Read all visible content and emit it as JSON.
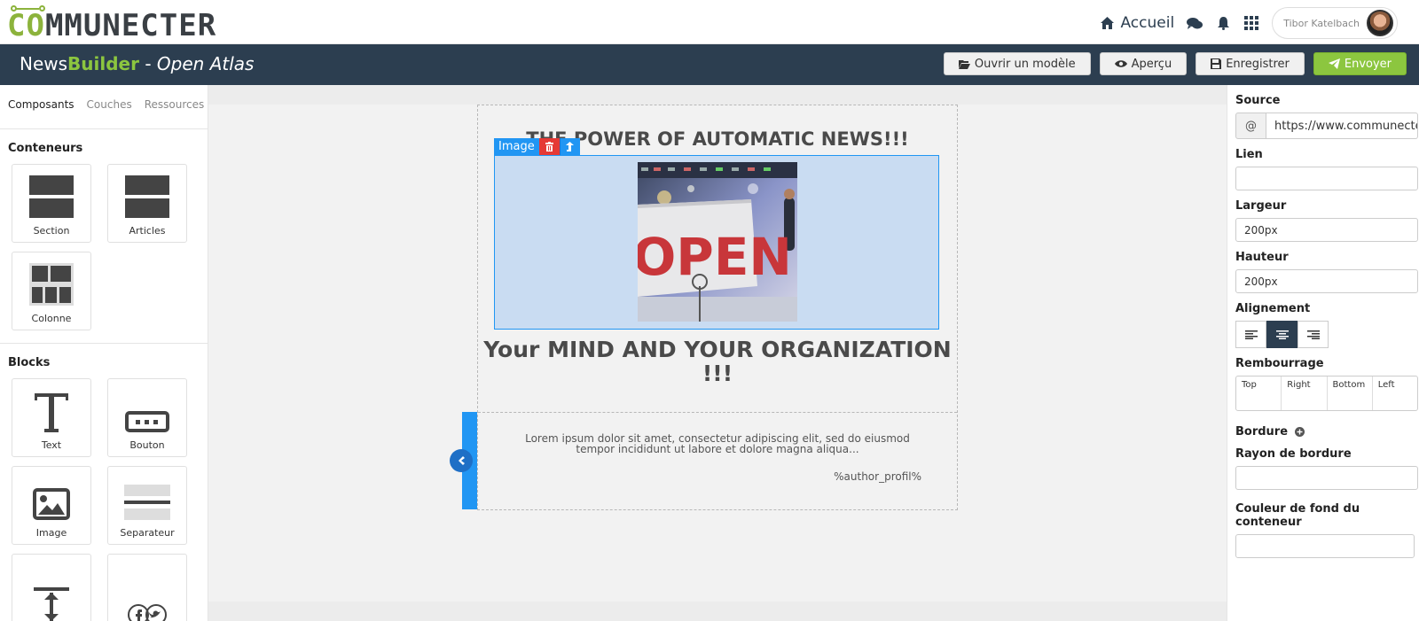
{
  "topbar": {
    "logo_co": "CO",
    "logo_rest": "MMUNECTER",
    "home_label": "Accueil",
    "user_name": "Tibor Katelbach"
  },
  "builder": {
    "title_news": "News",
    "title_builder": "Builder",
    "title_sep": " - ",
    "project": "Open Atlas",
    "buttons": {
      "open_model": "Ouvrir un modèle",
      "preview": "Aperçu",
      "save": "Enregistrer",
      "send": "Envoyer"
    }
  },
  "left": {
    "tabs": [
      "Composants",
      "Couches",
      "Ressources"
    ],
    "containers_title": "Conteneurs",
    "containers": [
      "Section",
      "Articles",
      "Colonne"
    ],
    "blocks_title": "Blocks",
    "blocks": [
      "Text",
      "Bouton",
      "Image",
      "Separateur"
    ]
  },
  "canvas": {
    "headline": "THE POWER OF AUTOMATIC NEWS!!!",
    "selection_label": "Image",
    "photo_sign": "OPEN",
    "subhead": "Your MIND AND YOUR ORGANIZATION !!!",
    "lorem": "Lorem ipsum dolor sit amet, consectetur adipiscing elit, sed do eiusmod tempor incididunt ut labore et dolore magna aliqua...",
    "author": "%author_profil%"
  },
  "right": {
    "source_label": "Source",
    "source_addon": "@",
    "source_value": "https://www.communecter.org",
    "link_label": "Lien",
    "link_value": "",
    "width_label": "Largeur",
    "width_value": "200px",
    "height_label": "Hauteur",
    "height_value": "200px",
    "align_label": "Alignement",
    "padding_label": "Rembourrage",
    "padding_cells": [
      "Top",
      "Right",
      "Bottom",
      "Left"
    ],
    "border_label": "Bordure",
    "radius_label": "Rayon de bordure",
    "radius_value": "",
    "bg_label": "Couleur de fond du conteneur",
    "bg_value": ""
  },
  "colors": {
    "brand_green": "#8cc63f",
    "header_dark": "#2c3e50",
    "selection_blue": "#2196f3",
    "delete_red": "#e53935"
  }
}
